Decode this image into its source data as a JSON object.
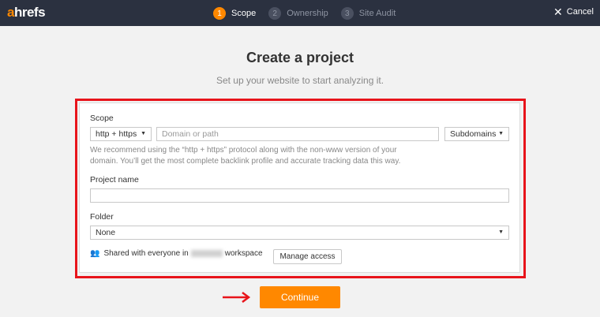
{
  "header": {
    "logo_prefix": "a",
    "logo_rest": "hrefs",
    "steps": [
      {
        "num": "1",
        "label": "Scope"
      },
      {
        "num": "2",
        "label": "Ownership"
      },
      {
        "num": "3",
        "label": "Site Audit"
      }
    ],
    "cancel_label": "Cancel"
  },
  "main": {
    "title": "Create a project",
    "subtitle": "Set up your website to start analyzing it."
  },
  "form": {
    "scope_label": "Scope",
    "protocol_value": "http + https",
    "domain_placeholder": "Domain or path",
    "mode_value": "Subdomains",
    "hint_line1": "We recommend using the “http + https” protocol along with the non-www version of your",
    "hint_line2": "domain. You’ll get the most complete backlink profile and accurate tracking data this way.",
    "project_name_label": "Project name",
    "project_name_value": "",
    "folder_label": "Folder",
    "folder_value": "None",
    "shared_prefix": "Shared with everyone in",
    "shared_suffix": "workspace",
    "manage_access_label": "Manage access"
  },
  "continue_label": "Continue",
  "colors": {
    "accent": "#ff8800",
    "highlight": "#e8141b",
    "topbar": "#2b3140"
  }
}
